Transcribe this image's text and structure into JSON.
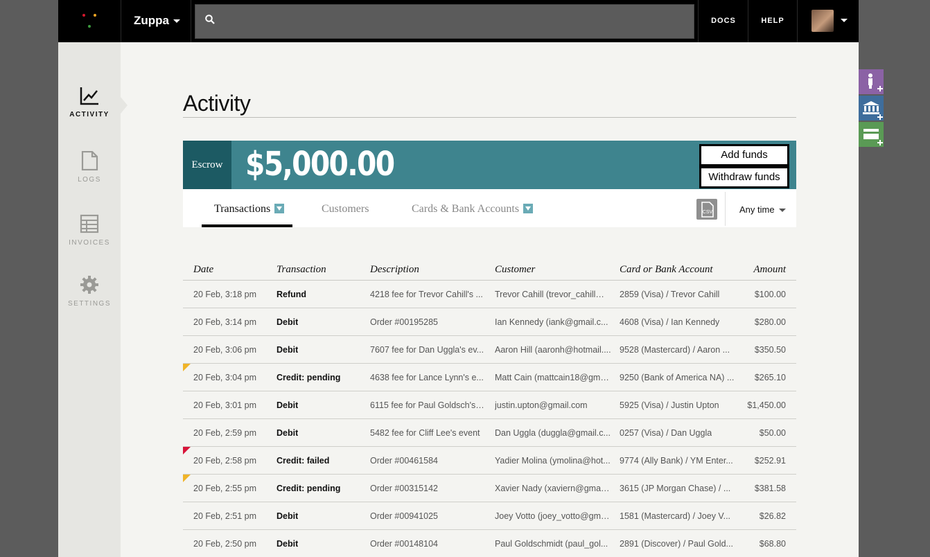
{
  "topbar": {
    "brand": "Zuppa",
    "search_placeholder": "",
    "nav": {
      "docs": "DOCS",
      "help": "HELP"
    },
    "logo_colors": [
      "#d3172c",
      "#f0a524",
      "#3d9c3f"
    ]
  },
  "sidebar": {
    "items": [
      {
        "label": "ACTIVITY",
        "icon": "chart-icon"
      },
      {
        "label": "LOGS",
        "icon": "document-icon"
      },
      {
        "label": "INVOICES",
        "icon": "invoice-icon"
      },
      {
        "label": "SETTINGS",
        "icon": "gear-icon"
      }
    ]
  },
  "page": {
    "title": "Activity"
  },
  "escrow": {
    "label": "Escrow",
    "balance": "$5,000.00",
    "add_funds": "Add funds",
    "withdraw_funds": "Withdraw funds"
  },
  "tabs": {
    "transactions": "Transactions",
    "customers": "Customers",
    "cards": "Cards & Bank Accounts",
    "csv_label": "CSV",
    "time_filter": "Any time"
  },
  "table": {
    "headers": {
      "date": "Date",
      "transaction": "Transaction",
      "description": "Description",
      "customer": "Customer",
      "account": "Card or Bank Account",
      "amount": "Amount"
    },
    "rows": [
      {
        "date": "20 Feb, 3:18 pm",
        "transaction": "Refund",
        "description": "4218 fee for Trevor Cahill's ...",
        "customer": "Trevor Cahill (trevor_cahill@...",
        "account": "2859 (Visa) / Trevor Cahill",
        "amount": "$100.00",
        "flag": ""
      },
      {
        "date": "20 Feb, 3:14 pm",
        "transaction": "Debit",
        "description": "Order #00195285",
        "customer": "Ian Kennedy (iank@gmail.c...",
        "account": "4608 (Visa) / Ian Kennedy",
        "amount": "$280.00",
        "flag": ""
      },
      {
        "date": "20 Feb, 3:06 pm",
        "transaction": "Debit",
        "description": "7607 fee for Dan Uggla's ev...",
        "customer": "Aaron Hill (aaronh@hotmail....",
        "account": "9528 (Mastercard) / Aaron ...",
        "amount": "$350.50",
        "flag": ""
      },
      {
        "date": "20 Feb, 3:04 pm",
        "transaction": "Credit: pending",
        "description": "4638 fee for Lance Lynn's e...",
        "customer": "Matt Cain (mattcain18@gma...",
        "account": "9250 (Bank of America NA) ...",
        "amount": "$265.10",
        "flag": "pending"
      },
      {
        "date": "20 Feb, 3:01 pm",
        "transaction": "Debit",
        "description": "6115 fee for Paul Goldsch's ...",
        "customer": "justin.upton@gmail.com",
        "account": "5925 (Visa) / Justin Upton",
        "amount": "$1,450.00",
        "flag": ""
      },
      {
        "date": "20 Feb, 2:59 pm",
        "transaction": "Debit",
        "description": "5482 fee for Cliff Lee's event",
        "customer": "Dan Uggla (duggla@gmail.c...",
        "account": "0257 (Visa) / Dan Uggla",
        "amount": "$50.00",
        "flag": ""
      },
      {
        "date": "20 Feb, 2:58 pm",
        "transaction": "Credit: failed",
        "description": "Order #00461584",
        "customer": "Yadier Molina (ymolina@hot...",
        "account": "9774 (Ally Bank) / YM Enter...",
        "amount": "$252.91",
        "flag": "failed"
      },
      {
        "date": "20 Feb, 2:55 pm",
        "transaction": "Credit: pending",
        "description": "Order #00315142",
        "customer": "Xavier Nady (xaviern@gmail....",
        "account": "3615 (JP Morgan Chase) / ...",
        "amount": "$381.58",
        "flag": "pending"
      },
      {
        "date": "20 Feb, 2:51 pm",
        "transaction": "Debit",
        "description": "Order #00941025",
        "customer": "Joey Votto (joey_votto@gma...",
        "account": "1581 (Mastercard) / Joey V...",
        "amount": "$26.82",
        "flag": ""
      },
      {
        "date": "20 Feb, 2:50 pm",
        "transaction": "Debit",
        "description": "Order #00148104",
        "customer": "Paul Goldschmidt (paul_gol...",
        "account": "2891 (Discover) / Paul Gold...",
        "amount": "$68.80",
        "flag": ""
      }
    ]
  },
  "colors": {
    "flag_pending": "#f0b429",
    "flag_failed": "#d8143a",
    "escrow_dark": "#1c5a63",
    "escrow_main": "#3e848e",
    "fab_person": "#8b62a5",
    "fab_bank": "#3e6d9c",
    "fab_card": "#5a9a55"
  },
  "side_actions": [
    {
      "icon": "person-add-icon"
    },
    {
      "icon": "bank-add-icon"
    },
    {
      "icon": "card-add-icon"
    }
  ]
}
